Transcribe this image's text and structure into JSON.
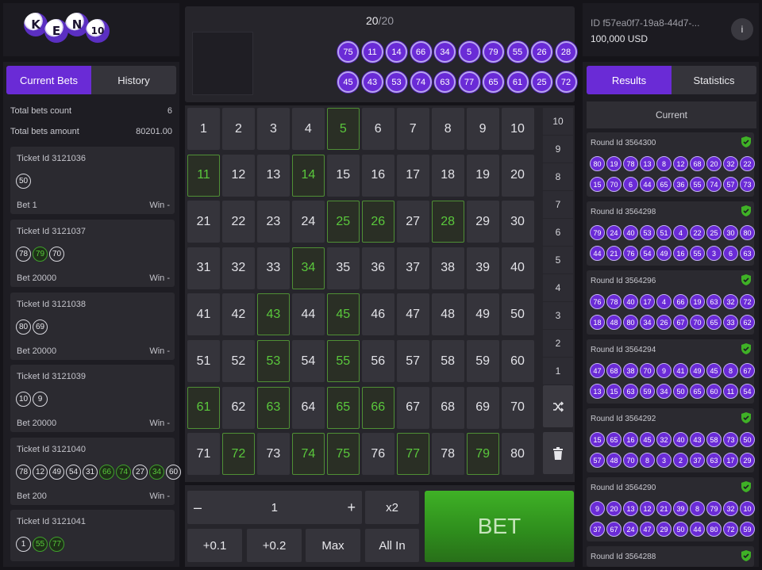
{
  "logo": {
    "letters": [
      "K",
      "E",
      "N",
      "10"
    ]
  },
  "bets": {
    "tabs": [
      {
        "label": "Current Bets",
        "active": true
      },
      {
        "label": "History",
        "active": false
      }
    ],
    "summary": [
      {
        "label": "Total bets count",
        "value": "6"
      },
      {
        "label": "Total bets amount",
        "value": "80201.00"
      }
    ],
    "tickets": [
      {
        "id": "Ticket Id 3121036",
        "numbers": [
          {
            "n": "50",
            "hit": false
          }
        ],
        "bet": "Bet 1",
        "win": "Win -"
      },
      {
        "id": "Ticket Id 3121037",
        "numbers": [
          {
            "n": "78",
            "hit": false
          },
          {
            "n": "79",
            "hit": true
          },
          {
            "n": "70",
            "hit": false
          }
        ],
        "bet": "Bet 20000",
        "win": "Win -"
      },
      {
        "id": "Ticket Id 3121038",
        "numbers": [
          {
            "n": "80",
            "hit": false
          },
          {
            "n": "69",
            "hit": false
          }
        ],
        "bet": "Bet 20000",
        "win": "Win -"
      },
      {
        "id": "Ticket Id 3121039",
        "numbers": [
          {
            "n": "10",
            "hit": false
          },
          {
            "n": "9",
            "hit": false
          }
        ],
        "bet": "Bet 20000",
        "win": "Win -"
      },
      {
        "id": "Ticket Id 3121040",
        "numbers": [
          {
            "n": "78",
            "hit": false
          },
          {
            "n": "12",
            "hit": false
          },
          {
            "n": "49",
            "hit": false
          },
          {
            "n": "54",
            "hit": false
          },
          {
            "n": "31",
            "hit": false
          },
          {
            "n": "66",
            "hit": true
          },
          {
            "n": "74",
            "hit": true
          },
          {
            "n": "27",
            "hit": false
          },
          {
            "n": "34",
            "hit": true
          },
          {
            "n": "60",
            "hit": false
          }
        ],
        "bet": "Bet 200",
        "win": "Win -"
      },
      {
        "id": "Ticket Id 3121041",
        "numbers": [
          {
            "n": "1",
            "hit": false
          },
          {
            "n": "55",
            "hit": true
          },
          {
            "n": "77",
            "hit": true
          }
        ],
        "bet": "",
        "win": ""
      }
    ]
  },
  "draw": {
    "count": "20",
    "total": "20",
    "row1": [
      "75",
      "11",
      "14",
      "66",
      "34",
      "5",
      "79",
      "55",
      "26",
      "28"
    ],
    "row2": [
      "45",
      "43",
      "53",
      "74",
      "63",
      "77",
      "65",
      "61",
      "25",
      "72"
    ]
  },
  "board": {
    "selected": [
      5,
      11,
      14,
      25,
      26,
      28,
      34,
      43,
      45,
      53,
      55,
      61,
      63,
      65,
      66,
      72,
      74,
      75,
      77,
      79
    ],
    "side_numbers": [
      "10",
      "9",
      "8",
      "7",
      "6",
      "5",
      "4",
      "3",
      "2",
      "1"
    ],
    "shuffle_icon": "shuffle-icon",
    "trash_icon": "trash-icon"
  },
  "controls": {
    "minus": "–",
    "amount": "1",
    "plus": "+",
    "x2": "x2",
    "plus01": "+0.1",
    "plus02": "+0.2",
    "max": "Max",
    "all_in": "All In",
    "bet": "BET"
  },
  "account": {
    "id": "ID f57ea0f7-19a8-44d7-...",
    "balance": "100,000 USD",
    "info": "i"
  },
  "results": {
    "tabs": [
      {
        "label": "Results",
        "active": true
      },
      {
        "label": "Statistics",
        "active": false
      }
    ],
    "current_label": "Current",
    "rounds": [
      {
        "id": "Round Id 3564300",
        "row1": [
          "80",
          "19",
          "78",
          "13",
          "8",
          "12",
          "68",
          "20",
          "32",
          "22"
        ],
        "row2": [
          "15",
          "70",
          "6",
          "44",
          "65",
          "36",
          "55",
          "74",
          "57",
          "73"
        ]
      },
      {
        "id": "Round Id 3564298",
        "row1": [
          "79",
          "24",
          "40",
          "53",
          "51",
          "4",
          "22",
          "25",
          "30",
          "80"
        ],
        "row2": [
          "44",
          "21",
          "76",
          "54",
          "49",
          "16",
          "55",
          "3",
          "6",
          "63"
        ]
      },
      {
        "id": "Round Id 3564296",
        "row1": [
          "76",
          "78",
          "40",
          "17",
          "4",
          "66",
          "19",
          "63",
          "32",
          "72"
        ],
        "row2": [
          "18",
          "48",
          "80",
          "34",
          "26",
          "67",
          "70",
          "65",
          "33",
          "62"
        ]
      },
      {
        "id": "Round Id 3564294",
        "row1": [
          "47",
          "68",
          "38",
          "70",
          "9",
          "41",
          "49",
          "45",
          "8",
          "67"
        ],
        "row2": [
          "13",
          "15",
          "63",
          "59",
          "34",
          "50",
          "65",
          "60",
          "11",
          "54"
        ]
      },
      {
        "id": "Round Id 3564292",
        "row1": [
          "15",
          "65",
          "16",
          "45",
          "32",
          "40",
          "43",
          "58",
          "73",
          "50"
        ],
        "row2": [
          "57",
          "48",
          "70",
          "8",
          "3",
          "2",
          "37",
          "63",
          "17",
          "29"
        ]
      },
      {
        "id": "Round Id 3564290",
        "row1": [
          "9",
          "20",
          "13",
          "12",
          "21",
          "39",
          "8",
          "79",
          "32",
          "10"
        ],
        "row2": [
          "37",
          "67",
          "24",
          "47",
          "29",
          "50",
          "44",
          "80",
          "72",
          "59"
        ]
      },
      {
        "id": "Round Id 3564288",
        "row1": [],
        "row2": []
      }
    ],
    "colors": {
      "ball": "#6a2bd6",
      "hit": "#58c93b",
      "shield": "#3fb126",
      "accent": "#6a2bd6"
    }
  }
}
